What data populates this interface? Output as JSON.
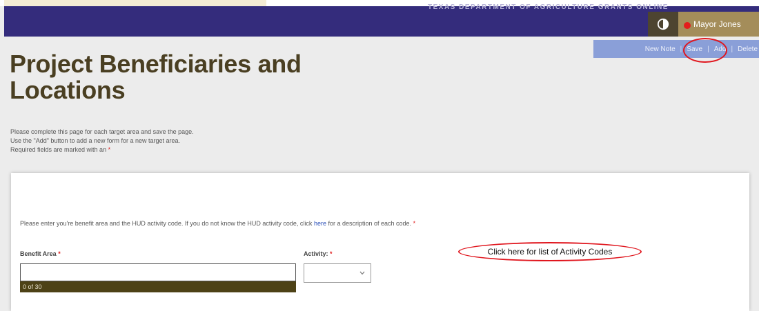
{
  "banner": {
    "text": "TEXAS DEPARTMENT OF AGRICULTURE GRANTS ONLINE"
  },
  "user": {
    "name": "Mayor Jones",
    "status_color": "#e41c1c"
  },
  "toolbar": {
    "new_note": "New Note",
    "save": "Save",
    "add": "Add",
    "delete": "Delete",
    "separator": "|"
  },
  "page": {
    "title_line1": "Project Beneficiaries and",
    "title_line2": "Locations"
  },
  "instructions": {
    "line1": "Please complete this page for each target area and save the page.",
    "line2": "Use the \"Add\" button to add a new form for a new target area.",
    "line3": "Required fields are marked with an",
    "required_marker": "*"
  },
  "form": {
    "hud_text_before": "Please enter you're benefit area and the HUD activity code. If you do not know the HUD activity code, click",
    "hud_link": "here",
    "hud_text_after": "for a description of each code.",
    "benefit_area_label": "Benefit Area",
    "activity_label": "Activity:",
    "benefit_area_value": "",
    "benefit_area_counter": "0 of 30",
    "activity_value": ""
  },
  "callout": {
    "text": "Click here for list of Activity Codes"
  },
  "colors": {
    "banner": "#342c7c",
    "toolbar": "#8a9fd8",
    "title": "#4a3f22",
    "user_box": "#a48d5a",
    "highlight": "#e0161e"
  },
  "icons": {
    "contrast": "contrast-icon",
    "select": "chevron-down-icon"
  }
}
